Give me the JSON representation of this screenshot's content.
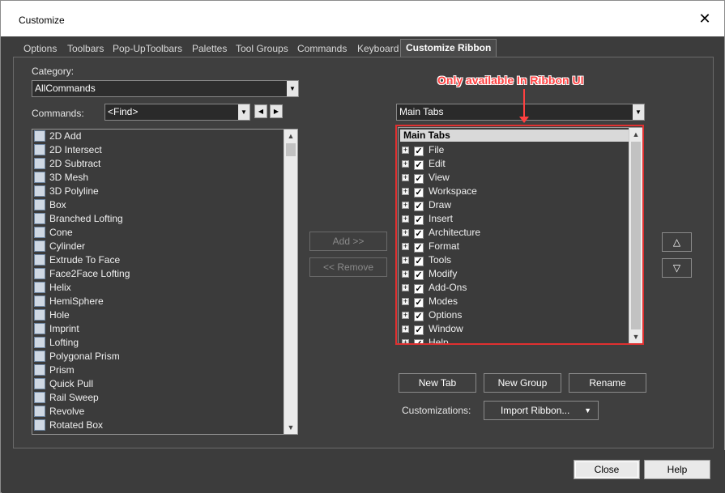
{
  "window": {
    "title": "Customize"
  },
  "tabs": [
    "Options",
    "Toolbars",
    "Pop-UpToolbars",
    "Palettes",
    "Tool Groups",
    "Commands",
    "Keyboard",
    "Customize Ribbon"
  ],
  "left": {
    "category_label": "Category:",
    "category_value": "AllCommands",
    "commands_label": "Commands:",
    "find_value": "<Find>",
    "items": [
      "2D Add",
      "2D Intersect",
      "2D Subtract",
      "3D Mesh",
      "3D Polyline",
      "Box",
      "Branched Lofting",
      "Cone",
      "Cylinder",
      "Extrude To Face",
      "Face2Face Lofting",
      "Helix",
      "HemiSphere",
      "Hole",
      "Imprint",
      "Lofting",
      "Polygonal Prism",
      "Prism",
      "Quick Pull",
      "Rail Sweep",
      "Revolve",
      "Rotated Box"
    ]
  },
  "middle": {
    "add_label": "Add >>",
    "remove_label": "<< Remove"
  },
  "right": {
    "annotation": "Only available In Ribbon UI",
    "tabs_combo_value": "Main Tabs",
    "tree_header": "Main Tabs",
    "tree_items": [
      "File",
      "Edit",
      "View",
      "Workspace",
      "Draw",
      "Insert",
      "Architecture",
      "Format",
      "Tools",
      "Modify",
      "Add-Ons",
      "Modes",
      "Options",
      "Window",
      "Help"
    ],
    "new_tab_label": "New Tab",
    "new_group_label": "New Group",
    "rename_label": "Rename",
    "customizations_label": "Customizations:",
    "import_label": "Import Ribbon..."
  },
  "footer": {
    "close_label": "Close",
    "help_label": "Help"
  },
  "colors": {
    "annotation": "#ff4040",
    "frame": "#e03030",
    "panel": "#3f3f3f"
  }
}
